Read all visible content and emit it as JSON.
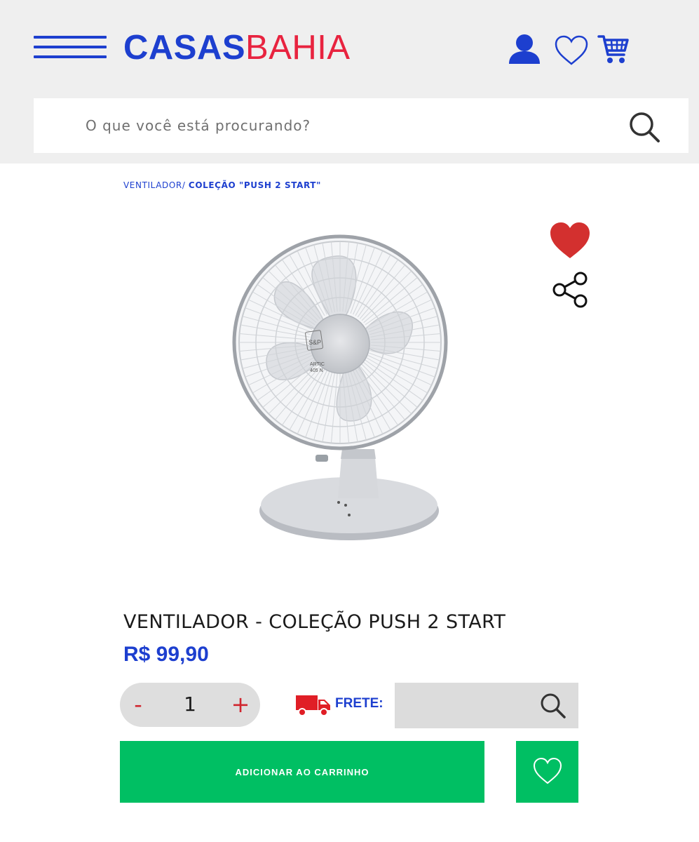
{
  "header": {
    "logo": {
      "part1": "CASAS",
      "part2": "BAHIA"
    },
    "icons": [
      "menu-icon",
      "user-icon",
      "heart-icon",
      "cart-icon"
    ],
    "colors": {
      "brand_blue": "#1d3fcf",
      "brand_red": "#e8233f",
      "header_bg": "#efefef"
    }
  },
  "search": {
    "placeholder": "O que você está procurando?",
    "value": ""
  },
  "breadcrumb": {
    "category": "VENTILADOR/",
    "current": "COLEÇÃO \"PUSH 2 START\""
  },
  "product": {
    "title": "VENTILADOR - COLEÇÃO PUSH 2 START",
    "price": "R$ 99,90",
    "image": "white desk fan",
    "fan_label": {
      "brand": "S&P",
      "model_line1": "ARTIC",
      "model_line2": "405 N"
    }
  },
  "quantity": {
    "minus": "-",
    "value": "1",
    "plus": "+"
  },
  "shipping": {
    "label": "FRETE:",
    "cep_value": ""
  },
  "actions": {
    "add_to_cart": "ADICIONAR AO CARRINHO",
    "button_color": "#00bf63"
  }
}
